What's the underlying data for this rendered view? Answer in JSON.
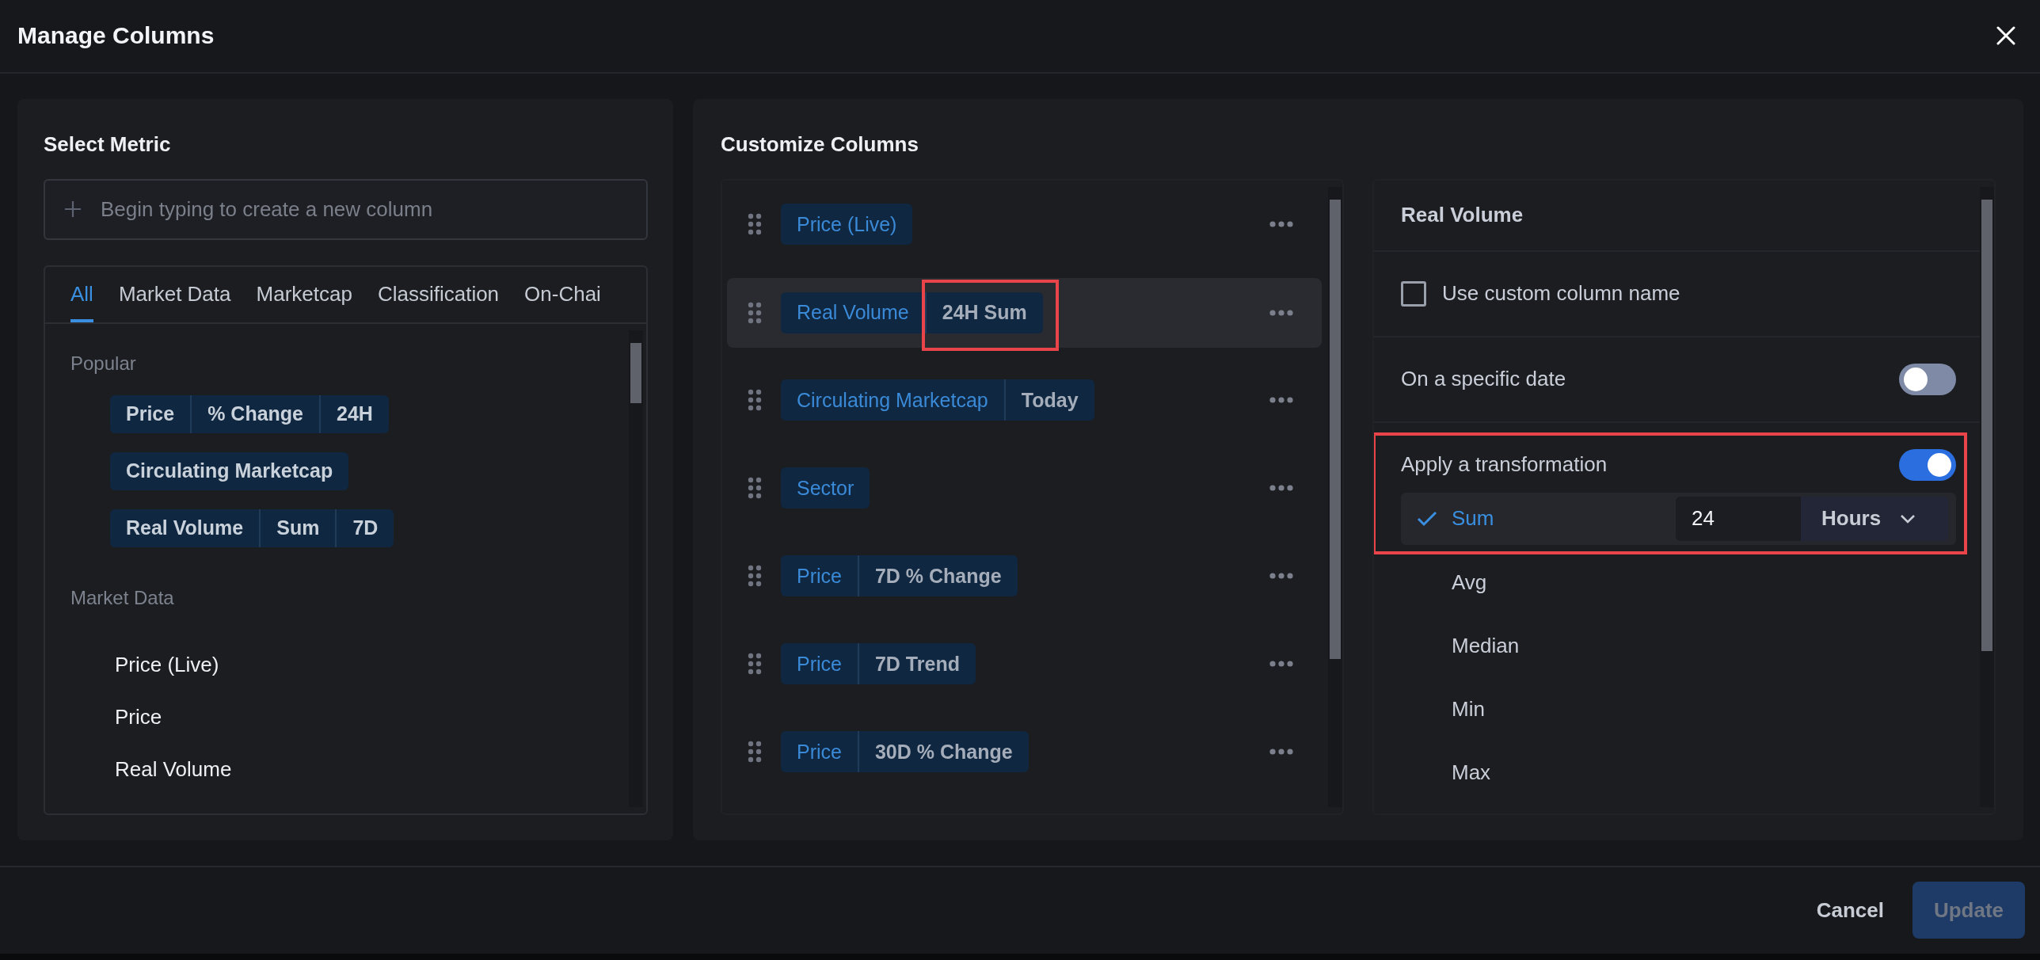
{
  "dialog": {
    "title": "Manage Columns"
  },
  "select_metric": {
    "title": "Select Metric",
    "search": {
      "placeholder": "Begin typing to create a new column"
    },
    "tabs": [
      {
        "label": "All",
        "selected": true
      },
      {
        "label": "Market Data",
        "selected": false
      },
      {
        "label": "Marketcap",
        "selected": false
      },
      {
        "label": "Classification",
        "selected": false
      },
      {
        "label": "On-Chai",
        "selected": false
      }
    ],
    "sections": [
      {
        "title": "Popular",
        "items": [
          {
            "kind": "chip",
            "parts": [
              "Price",
              "% Change",
              "24H"
            ]
          },
          {
            "kind": "chip",
            "parts": [
              "Circulating Marketcap"
            ]
          },
          {
            "kind": "chip",
            "parts": [
              "Real Volume",
              "Sum",
              "7D"
            ]
          }
        ]
      },
      {
        "title": "Market Data",
        "items": [
          {
            "kind": "plain",
            "label": "Price (Live)"
          },
          {
            "kind": "plain",
            "label": "Price"
          },
          {
            "kind": "plain",
            "label": "Real Volume"
          }
        ]
      }
    ]
  },
  "customize": {
    "title": "Customize Columns",
    "columns": [
      {
        "parts": [
          "Price (Live)"
        ],
        "selected": false,
        "highlighted": false
      },
      {
        "parts": [
          "Real Volume",
          "24H Sum"
        ],
        "selected": true,
        "highlighted": true
      },
      {
        "parts": [
          "Circulating Marketcap",
          "Today"
        ],
        "selected": false,
        "highlighted": false
      },
      {
        "parts": [
          "Sector"
        ],
        "selected": false,
        "highlighted": false
      },
      {
        "parts": [
          "Price",
          "7D % Change"
        ],
        "selected": false,
        "highlighted": false
      },
      {
        "parts": [
          "Price",
          "7D Trend"
        ],
        "selected": false,
        "highlighted": false
      },
      {
        "parts": [
          "Price",
          "30D % Change"
        ],
        "selected": false,
        "highlighted": false
      }
    ],
    "detail": {
      "title": "Real Volume",
      "custom_name": {
        "label": "Use custom column name",
        "checked": false
      },
      "specific_date": {
        "label": "On a specific date",
        "on": false
      },
      "transformation": {
        "label": "Apply a transformation",
        "on": true,
        "highlighted": true,
        "options": [
          {
            "label": "Sum",
            "selected": true,
            "amount": "24",
            "unit": "Hours"
          },
          {
            "label": "Avg",
            "selected": false
          },
          {
            "label": "Median",
            "selected": false
          },
          {
            "label": "Min",
            "selected": false
          },
          {
            "label": "Max",
            "selected": false
          }
        ]
      }
    }
  },
  "footer": {
    "cancel": "Cancel",
    "update": {
      "label": "Update",
      "disabled": true
    }
  }
}
